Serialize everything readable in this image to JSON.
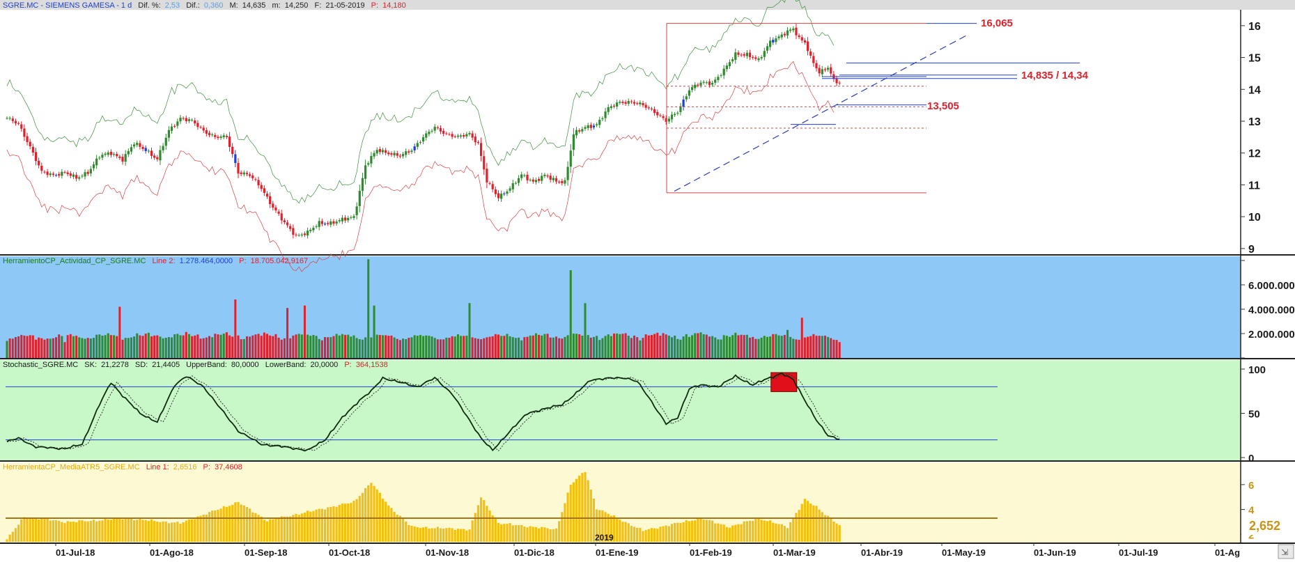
{
  "header": {
    "symbol": "SGRE.MC - SIEMENS GAMESA - 1 d",
    "dif_pct_label": "Dif. %:",
    "dif_pct": "2,53",
    "dif_label": "Dif.:",
    "dif": "0,360",
    "max_label": "M:",
    "max": "14,635",
    "min_label": "m:",
    "min": "14,250",
    "date_label": "F:",
    "date": "21-05-2019",
    "price_label": "P:",
    "price": "14,180"
  },
  "panels": {
    "activity": {
      "name": "HerramientoCP_Actividad_CP_SGRE.MC",
      "l2_label": "Line 2:",
      "l2": "1.278.464,0000",
      "p_label": "P:",
      "p": "18.705.042,9167"
    },
    "stoch": {
      "name": "Stochastic_SGRE.MC",
      "sk_label": "SK:",
      "sk": "21,2278",
      "sd_label": "SD:",
      "sd": "21,4405",
      "ub_label": "UpperBand:",
      "ub": "80,0000",
      "lb_label": "LowerBand:",
      "lb": "20,0000",
      "p_label": "P:",
      "p": "364,1538"
    },
    "atr": {
      "name": "HerramientaCP_MediaATR5_SGRE.MC",
      "l1_label": "Line 1:",
      "l1": "2,6516",
      "p_label": "P:",
      "p": "37,4608"
    }
  },
  "annotations": {
    "high": "16,065",
    "mid": "14,835 / 14,34",
    "low": "13,505",
    "atr_last": "2,652",
    "year": "2019"
  },
  "colors": {
    "up": "#2e8b2e",
    "down": "#e0202a",
    "neutral": "#1f3fcf",
    "stoch_bg": "#c8f7c8",
    "activity_bg": "#8ec8f7",
    "atr_bg": "#fdf9d3",
    "atr_bar": "#f3c012"
  },
  "chart_data": [
    {
      "type": "candlestick",
      "title": "SGRE.MC - SIEMENS GAMESA - 1 d",
      "ylim": [
        8.8,
        16.5
      ],
      "yticks": [
        9,
        10,
        11,
        12,
        13,
        14,
        15,
        16
      ],
      "xticks": [
        "01-Jul-18",
        "01-Ago-18",
        "01-Sep-18",
        "01-Oct-18",
        "01-Nov-18",
        "01-Dic-18",
        "01-Ene-19",
        "01-Feb-19",
        "01-Mar-19",
        "01-Abr-19",
        "01-May-19",
        "01-Jun-19",
        "01-Jul-19",
        "01-Ag"
      ],
      "close_anchors": [
        [
          0,
          13.1
        ],
        [
          4,
          12.9
        ],
        [
          8,
          12.2
        ],
        [
          12,
          11.4
        ],
        [
          16,
          11.3
        ],
        [
          20,
          11.4
        ],
        [
          24,
          11.2
        ],
        [
          28,
          11.4
        ],
        [
          32,
          11.9
        ],
        [
          36,
          12.0
        ],
        [
          40,
          11.8
        ],
        [
          44,
          12.3
        ],
        [
          48,
          12.1
        ],
        [
          52,
          11.8
        ],
        [
          56,
          12.7
        ],
        [
          60,
          13.1
        ],
        [
          64,
          13.0
        ],
        [
          68,
          12.7
        ],
        [
          72,
          12.5
        ],
        [
          76,
          12.5
        ],
        [
          80,
          11.4
        ],
        [
          84,
          11.3
        ],
        [
          88,
          10.9
        ],
        [
          92,
          10.3
        ],
        [
          96,
          9.8
        ],
        [
          100,
          9.4
        ],
        [
          104,
          9.5
        ],
        [
          108,
          9.8
        ],
        [
          112,
          9.8
        ],
        [
          116,
          9.9
        ],
        [
          120,
          10.0
        ],
        [
          124,
          11.6
        ],
        [
          128,
          12.1
        ],
        [
          132,
          12.0
        ],
        [
          136,
          11.9
        ],
        [
          140,
          12.1
        ],
        [
          144,
          12.5
        ],
        [
          148,
          12.8
        ],
        [
          152,
          12.6
        ],
        [
          156,
          12.5
        ],
        [
          160,
          12.6
        ],
        [
          163,
          12.3
        ],
        [
          166,
          11.1
        ],
        [
          170,
          10.6
        ],
        [
          174,
          10.9
        ],
        [
          178,
          11.3
        ],
        [
          182,
          11.1
        ],
        [
          186,
          11.3
        ],
        [
          190,
          11.1
        ],
        [
          193,
          11.1
        ],
        [
          196,
          12.6
        ],
        [
          200,
          12.8
        ],
        [
          204,
          12.9
        ],
        [
          208,
          13.4
        ],
        [
          212,
          13.6
        ],
        [
          216,
          13.6
        ],
        [
          220,
          13.5
        ],
        [
          224,
          13.3
        ],
        [
          228,
          13.0
        ],
        [
          232,
          13.3
        ],
        [
          236,
          14.0
        ],
        [
          240,
          14.2
        ],
        [
          244,
          14.2
        ],
        [
          248,
          14.6
        ],
        [
          252,
          15.1
        ],
        [
          256,
          15.1
        ],
        [
          260,
          14.9
        ],
        [
          264,
          15.5
        ],
        [
          268,
          15.7
        ],
        [
          272,
          15.9
        ],
        [
          274,
          15.6
        ],
        [
          276,
          15.5
        ],
        [
          278,
          15.0
        ],
        [
          281,
          14.5
        ],
        [
          284,
          14.7
        ],
        [
          286,
          14.3
        ],
        [
          288,
          14.2
        ]
      ],
      "last_price": 14.18
    },
    {
      "type": "bar",
      "title": "HerramientoCP_Actividad_CP_SGRE.MC",
      "ylim": [
        0,
        8000000
      ],
      "yticks": [
        "2.000.000",
        "4.000.000",
        "6.000.000"
      ],
      "value_anchors": [
        [
          0,
          1.4
        ],
        [
          10,
          1.5
        ],
        [
          20,
          1.3
        ],
        [
          39,
          4.2
        ],
        [
          79,
          4.8
        ],
        [
          97,
          4.1
        ],
        [
          103,
          4.3
        ],
        [
          125,
          8.1
        ],
        [
          127,
          4.3
        ],
        [
          160,
          4.5
        ],
        [
          195,
          7.2
        ],
        [
          200,
          4.5
        ],
        [
          240,
          2.1
        ],
        [
          270,
          2.3
        ],
        [
          275,
          3.3
        ],
        [
          288,
          1.3
        ]
      ],
      "base_level": 1.4
    },
    {
      "type": "line",
      "title": "Stochastic_SGRE.MC",
      "ylim": [
        0,
        100
      ],
      "yticks": [
        0,
        50,
        100
      ],
      "bands": [
        20,
        80
      ],
      "series": [
        {
          "name": "SK",
          "anchors": [
            [
              0,
              18
            ],
            [
              4,
              22
            ],
            [
              10,
              12
            ],
            [
              20,
              10
            ],
            [
              26,
              15
            ],
            [
              32,
              60
            ],
            [
              36,
              85
            ],
            [
              40,
              70
            ],
            [
              46,
              50
            ],
            [
              52,
              40
            ],
            [
              58,
              82
            ],
            [
              62,
              92
            ],
            [
              68,
              80
            ],
            [
              74,
              55
            ],
            [
              80,
              30
            ],
            [
              88,
              15
            ],
            [
              96,
              12
            ],
            [
              104,
              8
            ],
            [
              110,
              20
            ],
            [
              116,
              45
            ],
            [
              122,
              65
            ],
            [
              126,
              75
            ],
            [
              130,
              90
            ],
            [
              136,
              85
            ],
            [
              142,
              80
            ],
            [
              148,
              90
            ],
            [
              154,
              72
            ],
            [
              160,
              42
            ],
            [
              164,
              22
            ],
            [
              168,
              8
            ],
            [
              174,
              30
            ],
            [
              180,
              50
            ],
            [
              186,
              55
            ],
            [
              192,
              60
            ],
            [
              196,
              70
            ],
            [
              202,
              88
            ],
            [
              210,
              90
            ],
            [
              214,
              90
            ],
            [
              218,
              86
            ],
            [
              222,
              68
            ],
            [
              228,
              38
            ],
            [
              232,
              45
            ],
            [
              236,
              78
            ],
            [
              240,
              82
            ],
            [
              246,
              80
            ],
            [
              252,
              92
            ],
            [
              258,
              82
            ],
            [
              262,
              88
            ],
            [
              268,
              95
            ],
            [
              272,
              88
            ],
            [
              276,
              65
            ],
            [
              280,
              42
            ],
            [
              284,
              25
            ],
            [
              288,
              21
            ]
          ]
        }
      ],
      "highlight": {
        "from": 265,
        "to": 272
      }
    },
    {
      "type": "bar",
      "title": "HerramientaCP_MediaATR5_SGRE.MC",
      "ylim": [
        1.4,
        7
      ],
      "yticks": [
        2,
        4,
        6
      ],
      "value_anchors": [
        [
          0,
          1.6
        ],
        [
          6,
          3.4
        ],
        [
          14,
          3.2
        ],
        [
          20,
          3.0
        ],
        [
          30,
          3.1
        ],
        [
          40,
          3.3
        ],
        [
          50,
          3.1
        ],
        [
          60,
          2.9
        ],
        [
          80,
          4.6
        ],
        [
          90,
          3.1
        ],
        [
          110,
          4.1
        ],
        [
          120,
          4.6
        ],
        [
          126,
          6.2
        ],
        [
          132,
          4.3
        ],
        [
          140,
          2.6
        ],
        [
          160,
          2.4
        ],
        [
          164,
          5.0
        ],
        [
          170,
          2.9
        ],
        [
          190,
          2.4
        ],
        [
          195,
          6.0
        ],
        [
          200,
          7.1
        ],
        [
          204,
          4.1
        ],
        [
          220,
          2.3
        ],
        [
          240,
          3.3
        ],
        [
          250,
          2.6
        ],
        [
          260,
          3.3
        ],
        [
          270,
          2.6
        ],
        [
          276,
          4.8
        ],
        [
          280,
          4.2
        ],
        [
          288,
          2.7
        ]
      ],
      "ma_level": 3.3,
      "last_value": 2.652
    }
  ]
}
